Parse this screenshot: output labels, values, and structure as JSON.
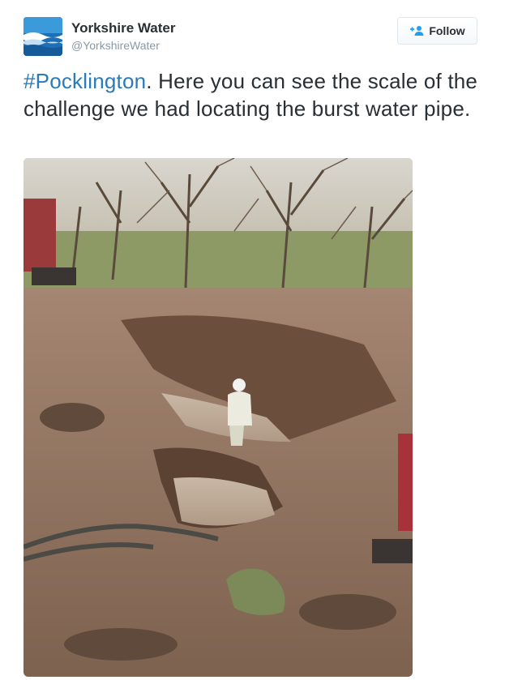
{
  "account": {
    "name": "Yorkshire Water",
    "handle": "@YorkshireWater",
    "brand_color": "#1a5fa6"
  },
  "follow": {
    "label": "Follow",
    "icon": "add-user-icon"
  },
  "tweet": {
    "hashtag": "#Pocklington",
    "text": ". Here you can see the scale of the challenge we had locating the burst water pipe."
  },
  "colors": {
    "text": "#292f33",
    "muted": "#8899a6",
    "link": "#2b7bb9"
  }
}
